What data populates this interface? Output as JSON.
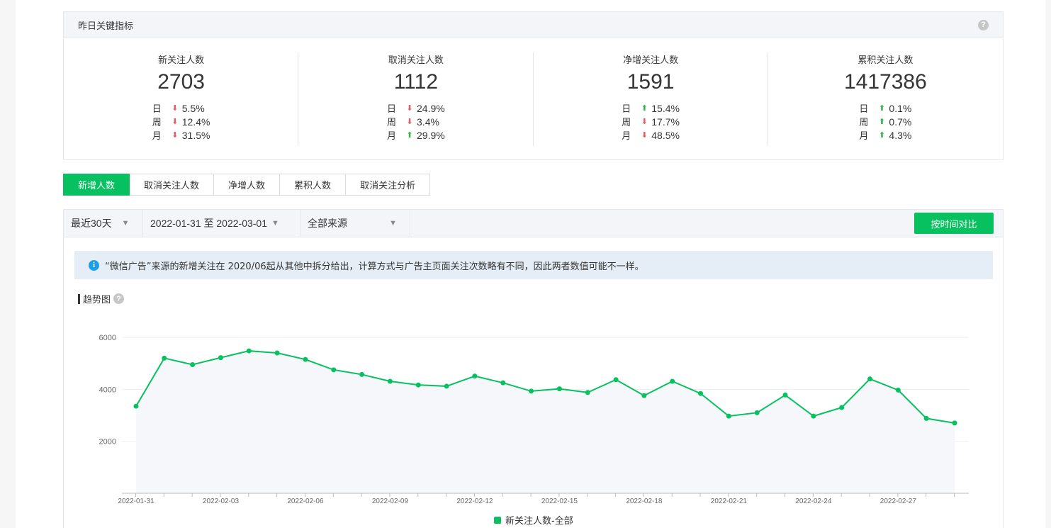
{
  "metrics": {
    "title": "昨日关键指标",
    "cards": [
      {
        "label": "新关注人数",
        "value": "2703",
        "changes": [
          {
            "period": "日",
            "direction": "down",
            "value": "5.5%"
          },
          {
            "period": "周",
            "direction": "down",
            "value": "12.4%"
          },
          {
            "period": "月",
            "direction": "down",
            "value": "31.5%"
          }
        ]
      },
      {
        "label": "取消关注人数",
        "value": "1112",
        "changes": [
          {
            "period": "日",
            "direction": "down",
            "value": "24.9%"
          },
          {
            "period": "周",
            "direction": "down",
            "value": "3.4%"
          },
          {
            "period": "月",
            "direction": "up",
            "value": "29.9%"
          }
        ]
      },
      {
        "label": "净增关注人数",
        "value": "1591",
        "changes": [
          {
            "period": "日",
            "direction": "up",
            "value": "15.4%"
          },
          {
            "period": "周",
            "direction": "down",
            "value": "17.7%"
          },
          {
            "period": "月",
            "direction": "down",
            "value": "48.5%"
          }
        ]
      },
      {
        "label": "累积关注人数",
        "value": "1417386",
        "changes": [
          {
            "period": "日",
            "direction": "up",
            "value": "0.1%"
          },
          {
            "period": "周",
            "direction": "up",
            "value": "0.7%"
          },
          {
            "period": "月",
            "direction": "up",
            "value": "4.3%"
          }
        ]
      }
    ]
  },
  "tabs": [
    {
      "label": "新增人数",
      "active": true
    },
    {
      "label": "取消关注人数",
      "active": false
    },
    {
      "label": "净增人数",
      "active": false
    },
    {
      "label": "累积人数",
      "active": false
    },
    {
      "label": "取消关注分析",
      "active": false
    }
  ],
  "filters": {
    "range": "最近30天",
    "dates": "2022-01-31 至 2022-03-01",
    "source": "全部来源",
    "compare_button": "按时间对比"
  },
  "notice": "“微信广告”来源的新增关注在 2020/06起从其他中拆分给出，计算方式与广告主页面关注次数略有不同，因此两者数值可能不一样。",
  "trend_title": "趋势图",
  "colors": {
    "accent": "#07c160",
    "up": "#31b54b",
    "down": "#e15f63"
  },
  "chart_data": {
    "type": "line",
    "x": [
      "2022-01-31",
      "2022-02-01",
      "2022-02-02",
      "2022-02-03",
      "2022-02-04",
      "2022-02-05",
      "2022-02-06",
      "2022-02-07",
      "2022-02-08",
      "2022-02-09",
      "2022-02-10",
      "2022-02-11",
      "2022-02-12",
      "2022-02-13",
      "2022-02-14",
      "2022-02-15",
      "2022-02-16",
      "2022-02-17",
      "2022-02-18",
      "2022-02-19",
      "2022-02-20",
      "2022-02-21",
      "2022-02-22",
      "2022-02-23",
      "2022-02-24",
      "2022-02-25",
      "2022-02-26",
      "2022-02-27",
      "2022-02-28",
      "2022-03-01"
    ],
    "x_tick_labels": [
      "2022-01-31",
      "2022-02-03",
      "2022-02-06",
      "2022-02-09",
      "2022-02-12",
      "2022-02-15",
      "2022-02-18",
      "2022-02-21",
      "2022-02-24",
      "2022-02-27"
    ],
    "series": [
      {
        "name": "新关注人数-全部",
        "color": "#07c160",
        "values": [
          3350,
          5200,
          4950,
          5220,
          5480,
          5400,
          5150,
          4750,
          4570,
          4310,
          4170,
          4120,
          4510,
          4250,
          3930,
          4020,
          3880,
          4370,
          3760,
          4310,
          3840,
          2970,
          3100,
          3780,
          2970,
          3300,
          4400,
          3970,
          2880,
          2703
        ]
      }
    ],
    "yticks": [
      2000,
      4000,
      6000
    ],
    "ylim": [
      0,
      6000
    ],
    "grid": true,
    "legend": "bottom-center"
  }
}
